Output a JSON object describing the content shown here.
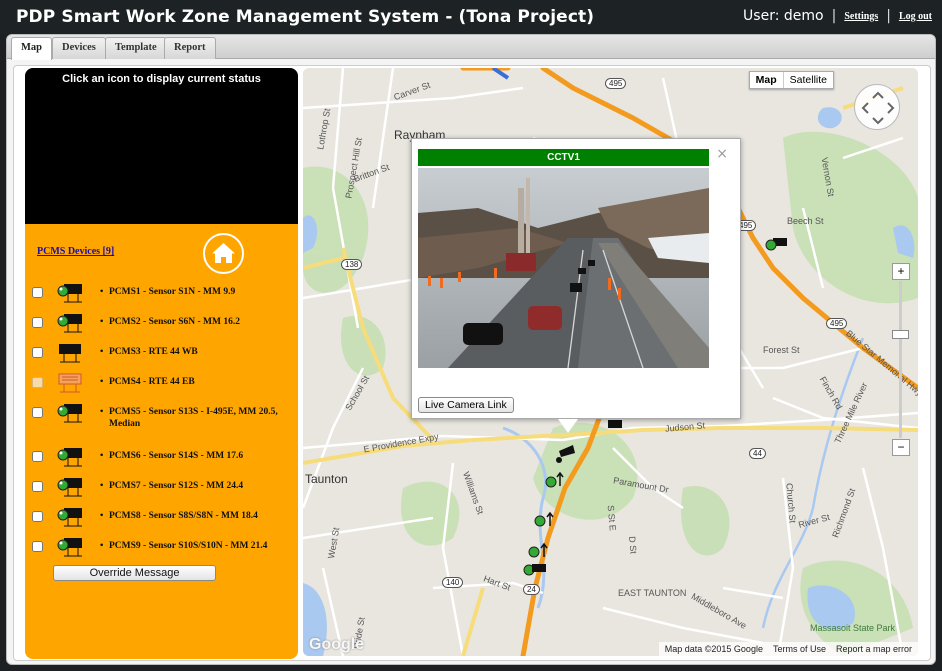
{
  "header": {
    "title": "PDP Smart Work Zone Management System - (Tona Project)",
    "user": "User: demo",
    "settings": "Settings",
    "logout": "Log out",
    "separator": "|"
  },
  "tabs": [
    "Map",
    "Devices",
    "Template",
    "Report"
  ],
  "left_panel": {
    "status_message": "Click an icon to display current status",
    "pcms_link": "PCMS Devices [9]",
    "devices": [
      {
        "label": "PCMS1 - Sensor S1N - MM 9.9",
        "icon": "sign-with-sensor-icon"
      },
      {
        "label": "PCMS2 - Sensor S6N - MM 16.2",
        "icon": "sign-with-sensor-icon"
      },
      {
        "label": "PCMS3 - RTE 44 WB",
        "icon": "sign-icon"
      },
      {
        "label": "PCMS4 - RTE 44 EB",
        "icon": "sign-alert-icon"
      },
      {
        "label": "PCMS5 - Sensor S13S - I-495E, MM 20.5, Median",
        "icon": "sign-with-sensor-icon"
      },
      {
        "label": "PCMS6 - Sensor S14S - MM 17.6",
        "icon": "sign-with-sensor-icon"
      },
      {
        "label": "PCMS7 - Sensor S12S - MM 24.4",
        "icon": "sign-with-sensor-icon"
      },
      {
        "label": "PCMS8 - Sensor S8S/S8N - MM 18.4",
        "icon": "sign-with-sensor-icon"
      },
      {
        "label": "PCMS9 - Sensor S10S/S10N - MM 21.4",
        "icon": "sign-with-sensor-icon"
      }
    ],
    "bullet": "•",
    "override_button": "Override Message"
  },
  "map": {
    "type_buttons": [
      "Map",
      "Satellite"
    ],
    "zoom_in": "+",
    "zoom_out": "−",
    "labels": {
      "raynham": "Raynham",
      "taunton": "Taunton",
      "east_taunton": "EAST TAUNTON",
      "massasoit": "Massasoit State Park",
      "carver": "Carver St",
      "lothrop": "Lothrop St",
      "prospect": "Prospect Hill St",
      "britton": "Britton St",
      "school": "School St",
      "e_providence": "E Providence Expy",
      "williams": "Williams St",
      "paramount": "Paramount Dr",
      "hart": "Hart St",
      "middleboro": "Middleboro Ave",
      "judson": "Judson St",
      "forest": "Forest St",
      "finch": "Finch Rd",
      "beech": "Beech St",
      "vernon": "Vernon St",
      "church": "Church St",
      "richmond": "Richmond St",
      "river": "River St",
      "three_mile": "Three Mile River",
      "blue_star": "Blue Star Memorial Hwy",
      "west": "West St",
      "pride": "Pride St",
      "s_st_e": "S St E",
      "d_st": "D St"
    },
    "shields": {
      "i495_a": "495",
      "i495_b": "495",
      "i495_c": "495",
      "r138": "138",
      "r140": "140",
      "r44": "44",
      "r24": "24"
    },
    "popup": {
      "title": "CCTV1",
      "close": "×",
      "link": "Live Camera Link"
    },
    "footer": {
      "google": "Google",
      "data": "Map data ©2015 Google",
      "terms": "Terms of Use",
      "report": "Report a map error"
    }
  },
  "colors": {
    "panel_orange": "#ffa500",
    "header_green": "#008000",
    "highway": "#f39b1f"
  }
}
